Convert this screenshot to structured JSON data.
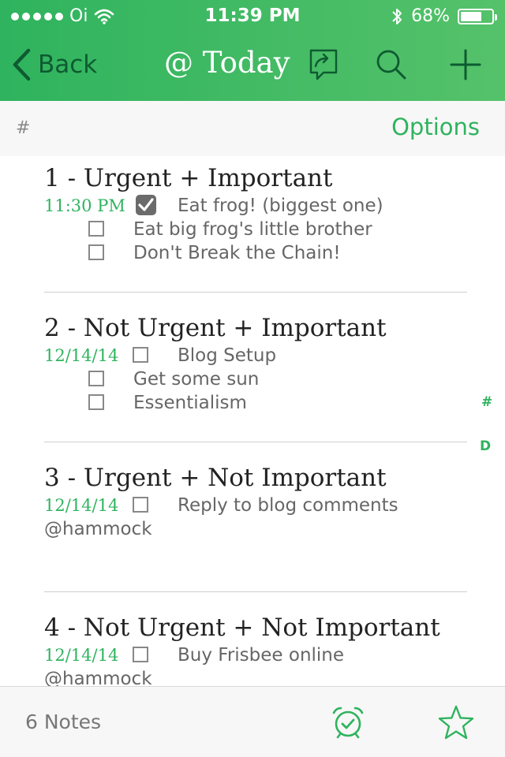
{
  "status_bar": {
    "carrier": "Oi",
    "time": "11:39 PM",
    "battery": "68%",
    "battery_level": 0.68
  },
  "nav": {
    "back_label": "Back",
    "title": "@ Today"
  },
  "subheader": {
    "hash": "#",
    "options_label": "Options"
  },
  "sections": [
    {
      "title": "1 - Urgent + Important",
      "tasks": [
        {
          "date": "11:30 PM",
          "text": "Eat frog! (biggest one)",
          "checked": true
        },
        {
          "text": "Eat big frog's little brother",
          "checked": false
        },
        {
          "text": "Don't Break the Chain!",
          "checked": false
        }
      ]
    },
    {
      "title": "2 - Not Urgent + Important",
      "tasks": [
        {
          "date": "12/14/14",
          "text": "Blog Setup",
          "checked": false
        },
        {
          "text": "Get some sun",
          "checked": false
        },
        {
          "text": "Essentialism",
          "checked": false
        }
      ]
    },
    {
      "title": "3 - Urgent + Not Important",
      "tasks": [
        {
          "date": "12/14/14",
          "text": "Reply to blog comments",
          "checked": false
        }
      ],
      "context": "@hammock"
    },
    {
      "title": "4 - Not Urgent + Not Important",
      "tasks": [
        {
          "date": "12/14/14",
          "text": "Buy Frisbee online",
          "checked": false
        }
      ],
      "context": "@hammock"
    }
  ],
  "index": {
    "hash": "#",
    "d": "D"
  },
  "footer": {
    "notes_count": "6 Notes"
  },
  "icons": {
    "back": "chevron-left-icon",
    "share": "share-chat-icon",
    "search": "search-icon",
    "add": "plus-icon",
    "reminder": "alarm-clock-icon",
    "shortcuts": "star-icon"
  },
  "colors": {
    "brand_green": "#2fb35e",
    "header_green_end": "#55c26a",
    "back_dark_green": "#0e5b31",
    "checked_box": "#6b6b6b"
  }
}
